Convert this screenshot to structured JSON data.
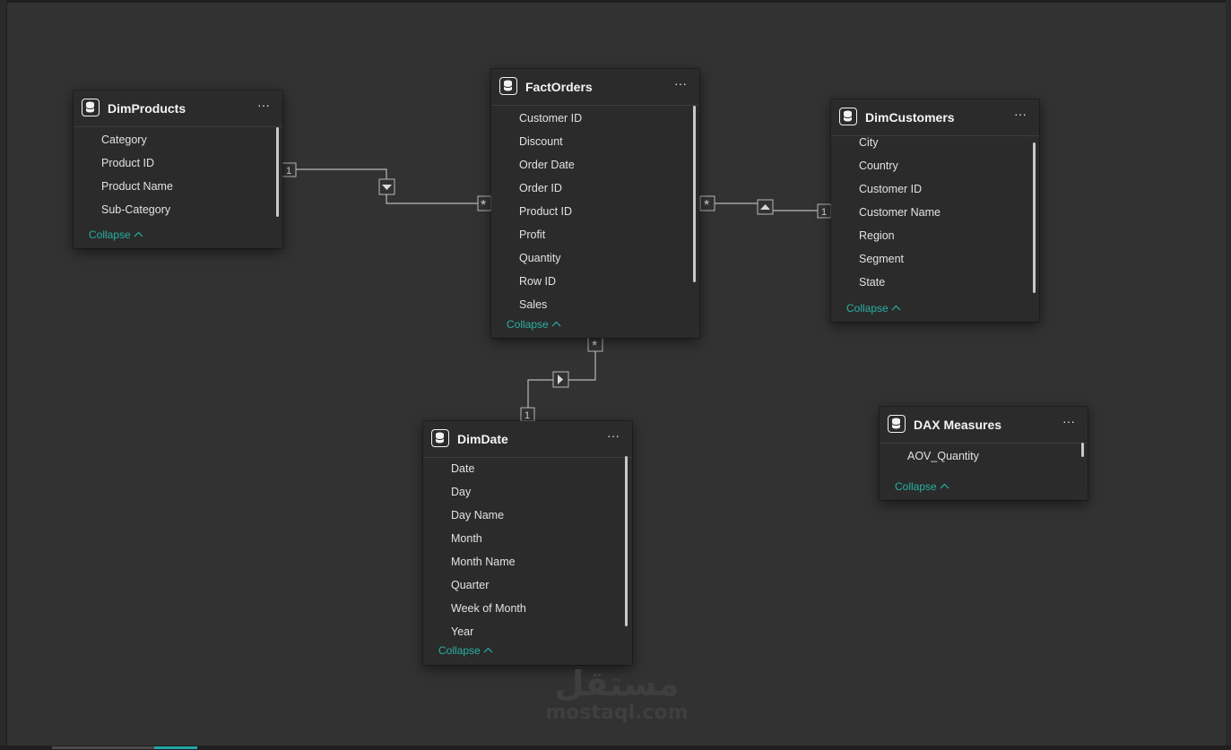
{
  "tables": {
    "dimproducts": {
      "title": "DimProducts",
      "fields": [
        "Category",
        "Product ID",
        "Product Name",
        "Sub-Category"
      ],
      "collapse_label": "Collapse"
    },
    "factorders": {
      "title": "FactOrders",
      "fields": [
        "Customer ID",
        "Discount",
        "Order Date",
        "Order ID",
        "Product ID",
        "Profit",
        "Quantity",
        "Row ID",
        "Sales"
      ],
      "collapse_label": "Collapse"
    },
    "dimcustomers": {
      "title": "DimCustomers",
      "fields": [
        "City",
        "Country",
        "Customer ID",
        "Customer Name",
        "Region",
        "Segment",
        "State"
      ],
      "collapse_label": "Collapse"
    },
    "dimdate": {
      "title": "DimDate",
      "fields": [
        "Date",
        "Day",
        "Day Name",
        "Month",
        "Month Name",
        "Quarter",
        "Week of Month",
        "Year"
      ],
      "collapse_label": "Collapse"
    },
    "daxmeasures": {
      "title": "DAX Measures",
      "fields": [
        "AOV_Quantity"
      ],
      "collapse_label": "Collapse"
    }
  },
  "relationships": {
    "one_label": "1",
    "many_label": "*"
  },
  "more_label": "···",
  "watermark": {
    "arabic": "مستقل",
    "latin": "mostaql.com"
  },
  "colors": {
    "canvas": "#323232",
    "card": "#2b2b2b",
    "accent": "#27b1a3",
    "line": "#b8b8b8"
  },
  "icons": {
    "table": "database-icon",
    "more": "more-options-icon",
    "collapse": "chevron-up-icon",
    "filter_direction": "triangle-arrow-icon"
  }
}
